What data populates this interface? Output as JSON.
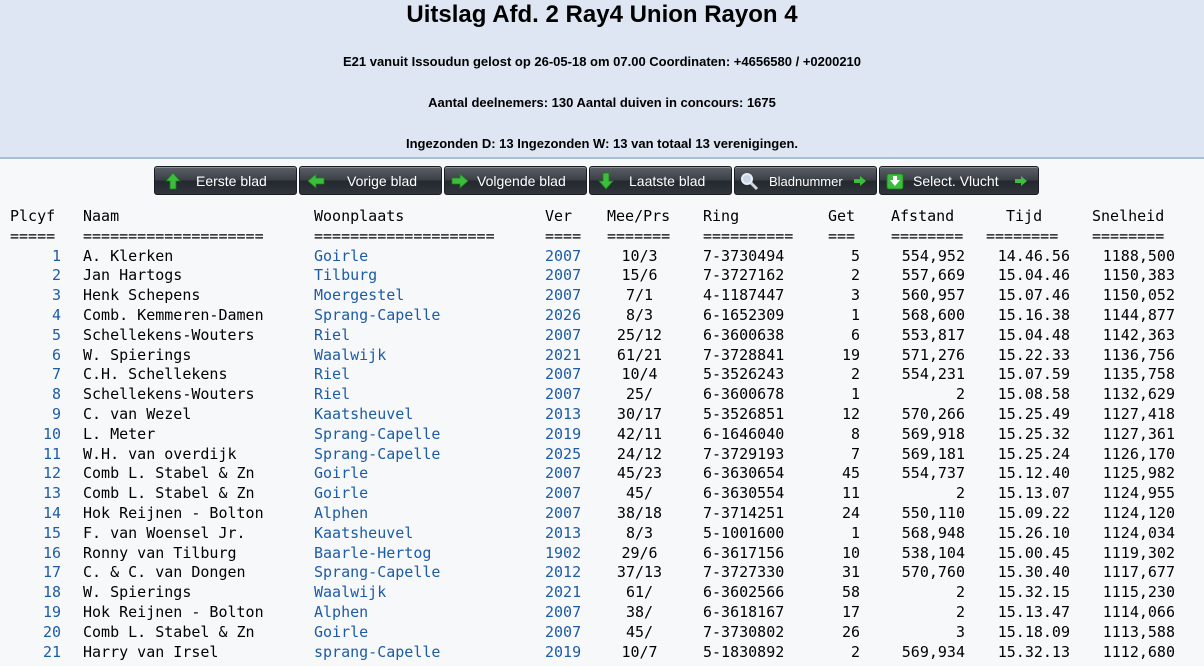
{
  "header": {
    "title": "Uitslag Afd. 2 Ray4 Union Rayon 4",
    "flight": "E21 vanuit Issoudun gelost op 26-05-18 om 07.00 Coordinaten: +4656580 / +0200210",
    "participants": "Aantal deelnemers: 130 Aantal duiven in concours: 1675",
    "submitted": "Ingezonden D: 13 Ingezonden W: 13 van totaal 13 verenigingen."
  },
  "nav": {
    "first": "Eerste blad",
    "prev": "Vorige blad",
    "next": "Volgende blad",
    "last": "Laatste blad",
    "page_number": "Bladnummer",
    "select_flight": "Select. Vlucht"
  },
  "columns": {
    "plcyf": "Plcyf",
    "naam": "Naam",
    "woonplaats": "Woonplaats",
    "ver": "Ver",
    "meeprs": "Mee/Prs",
    "ring": "Ring",
    "get": "Get",
    "afstand": "Afstand",
    "tijd": "Tijd",
    "snelheid": "Snelheid"
  },
  "separators": {
    "plcyf": "=====",
    "naam": "====================",
    "woonplaats": "====================",
    "ver": "====",
    "meeprs": "=======",
    "ring": "==========",
    "get": "===",
    "afstand": "========",
    "tijd": "========",
    "snelheid": "========"
  },
  "rows": [
    [
      "1",
      "A. Klerken",
      "Goirle",
      "2007",
      "10/3",
      "7-3730494",
      "5",
      "554,952",
      "14.46.56",
      "1188,500"
    ],
    [
      "2",
      "Jan Hartogs",
      "Tilburg",
      "2007",
      "15/6",
      "7-3727162",
      "2",
      "557,669",
      "15.04.46",
      "1150,383"
    ],
    [
      "3",
      "Henk Schepens",
      "Moergestel",
      "2007",
      "7/1",
      "4-1187447",
      "3",
      "560,957",
      "15.07.46",
      "1150,052"
    ],
    [
      "4",
      "Comb. Kemmeren-Damen",
      "Sprang-Capelle",
      "2026",
      "8/3",
      "6-1652309",
      "1",
      "568,600",
      "15.16.38",
      "1144,877"
    ],
    [
      "5",
      "Schellekens-Wouters",
      "Riel",
      "2007",
      "25/12",
      "6-3600638",
      "6",
      "553,817",
      "15.04.48",
      "1142,363"
    ],
    [
      "6",
      "W. Spierings",
      "Waalwijk",
      "2021",
      "61/21",
      "7-3728841",
      "19",
      "571,276",
      "15.22.33",
      "1136,756"
    ],
    [
      "7",
      "C.H. Schellekens",
      "Riel",
      "2007",
      "10/4",
      "5-3526243",
      "2",
      "554,231",
      "15.07.59",
      "1135,758"
    ],
    [
      "8",
      "Schellekens-Wouters",
      "Riel",
      "2007",
      "25/",
      "6-3600678",
      "1",
      "2",
      "15.08.58",
      "1132,629"
    ],
    [
      "9",
      "C. van Wezel",
      "Kaatsheuvel",
      "2013",
      "30/17",
      "5-3526851",
      "12",
      "570,266",
      "15.25.49",
      "1127,418"
    ],
    [
      "10",
      "L. Meter",
      "Sprang-Capelle",
      "2019",
      "42/11",
      "6-1646040",
      "8",
      "569,918",
      "15.25.32",
      "1127,361"
    ],
    [
      "11",
      "W.H. van overdijk",
      "Sprang-Capelle",
      "2025",
      "24/12",
      "7-3729193",
      "7",
      "569,181",
      "15.25.24",
      "1126,170"
    ],
    [
      "12",
      "Comb L. Stabel & Zn",
      "Goirle",
      "2007",
      "45/23",
      "6-3630654",
      "45",
      "554,737",
      "15.12.40",
      "1125,982"
    ],
    [
      "13",
      "Comb L. Stabel & Zn",
      "Goirle",
      "2007",
      "45/",
      "6-3630554",
      "11",
      "2",
      "15.13.07",
      "1124,955"
    ],
    [
      "14",
      "Hok Reijnen - Bolton",
      "Alphen",
      "2007",
      "38/18",
      "7-3714251",
      "24",
      "550,110",
      "15.09.22",
      "1124,120"
    ],
    [
      "15",
      "F. van Woensel Jr.",
      "Kaatsheuvel",
      "2013",
      "8/3",
      "5-1001600",
      "1",
      "568,948",
      "15.26.10",
      "1124,034"
    ],
    [
      "16",
      "Ronny van Tilburg",
      "Baarle-Hertog",
      "1902",
      "29/6",
      "6-3617156",
      "10",
      "538,104",
      "15.00.45",
      "1119,302"
    ],
    [
      "17",
      "C. & C. van Dongen",
      "Sprang-Capelle",
      "2012",
      "37/13",
      "7-3727330",
      "31",
      "570,760",
      "15.30.40",
      "1117,677"
    ],
    [
      "18",
      "W. Spierings",
      "Waalwijk",
      "2021",
      "61/",
      "6-3602566",
      "58",
      "2",
      "15.32.15",
      "1115,230"
    ],
    [
      "19",
      "Hok Reijnen - Bolton",
      "Alphen",
      "2007",
      "38/",
      "6-3618167",
      "17",
      "2",
      "15.13.47",
      "1114,066"
    ],
    [
      "20",
      "Comb L. Stabel & Zn",
      "Goirle",
      "2007",
      "45/",
      "7-3730802",
      "26",
      "3",
      "15.18.09",
      "1113,588"
    ],
    [
      "21",
      "Harry van Irsel",
      "sprang-Capelle",
      "2019",
      "10/7",
      "5-1830892",
      "2",
      "569,934",
      "15.32.13",
      "1112,680"
    ]
  ],
  "colors": {
    "header_bg": "#dde6f2",
    "link_blue": "#1c5ba8",
    "button_dark": "#30353c",
    "icon_green": "#3dbd3d"
  },
  "icons": {
    "first": "arrow-up-icon",
    "prev": "arrow-left-icon",
    "next": "arrow-right-icon",
    "last": "arrow-down-icon",
    "page_number": "magnifier-icon",
    "select_flight": "download-box-icon"
  }
}
